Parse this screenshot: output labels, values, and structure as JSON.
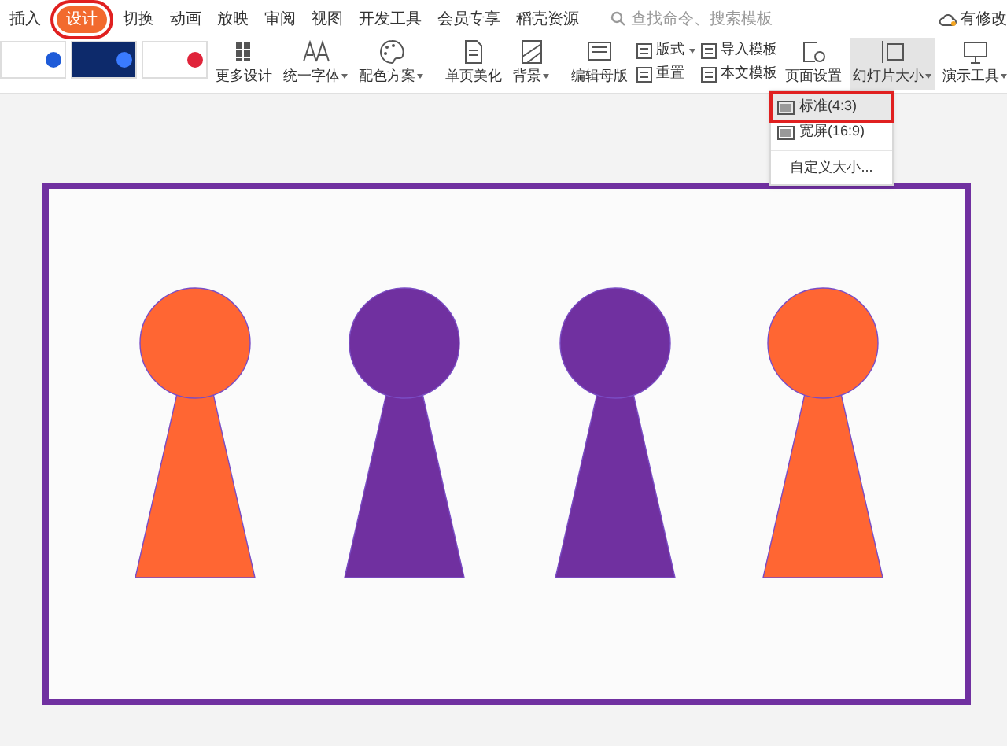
{
  "tabs": [
    {
      "label": "插入",
      "selected": false
    },
    {
      "label": "设计",
      "selected": true
    },
    {
      "label": "切换",
      "selected": false
    },
    {
      "label": "动画",
      "selected": false
    },
    {
      "label": "放映",
      "selected": false
    },
    {
      "label": "审阅",
      "selected": false
    },
    {
      "label": "视图",
      "selected": false
    },
    {
      "label": "开发工具",
      "selected": false
    },
    {
      "label": "会员专享",
      "selected": false
    },
    {
      "label": "稻壳资源",
      "selected": false
    }
  ],
  "search": {
    "placeholder": "查找命令、搜索模板"
  },
  "status_link": "有修改",
  "ribbon": [
    {
      "kind": "thumbs"
    },
    {
      "kind": "large",
      "label": "更多设计",
      "dropdown": false,
      "active": false
    },
    {
      "kind": "large",
      "label": "统一字体",
      "dropdown": true,
      "active": false
    },
    {
      "kind": "large",
      "label": "配色方案",
      "dropdown": true,
      "active": false
    },
    {
      "kind": "sep"
    },
    {
      "kind": "large",
      "label": "单页美化",
      "dropdown": false,
      "active": false
    },
    {
      "kind": "large",
      "label": "背景",
      "dropdown": true,
      "active": false
    },
    {
      "kind": "sep"
    },
    {
      "kind": "large",
      "label": "编辑母版",
      "dropdown": false,
      "active": false
    },
    {
      "kind": "stack",
      "items": [
        {
          "label": "版式",
          "dropdown": true
        },
        {
          "label": "重置",
          "dropdown": false
        }
      ]
    },
    {
      "kind": "stack",
      "items": [
        {
          "label": "导入模板",
          "dropdown": false
        },
        {
          "label": "本文模板",
          "dropdown": false
        }
      ]
    },
    {
      "kind": "large",
      "label": "页面设置",
      "dropdown": false,
      "active": false
    },
    {
      "kind": "large",
      "label": "幻灯片大小",
      "dropdown": true,
      "active": true
    },
    {
      "kind": "large",
      "label": "演示工具",
      "dropdown": true,
      "active": false
    }
  ],
  "size_menu": [
    {
      "label": "标准(4:3)",
      "kind": "icon",
      "selected": true
    },
    {
      "label": "宽屏(16:9)",
      "kind": "icon",
      "selected": false
    },
    {
      "label": "自定义大小...",
      "kind": "text",
      "selected": false
    }
  ],
  "slide": {
    "figures": [
      {
        "color": "#ff6633"
      },
      {
        "color": "#7030a0"
      },
      {
        "color": "#7030a0"
      },
      {
        "color": "#ff6633"
      }
    ]
  }
}
